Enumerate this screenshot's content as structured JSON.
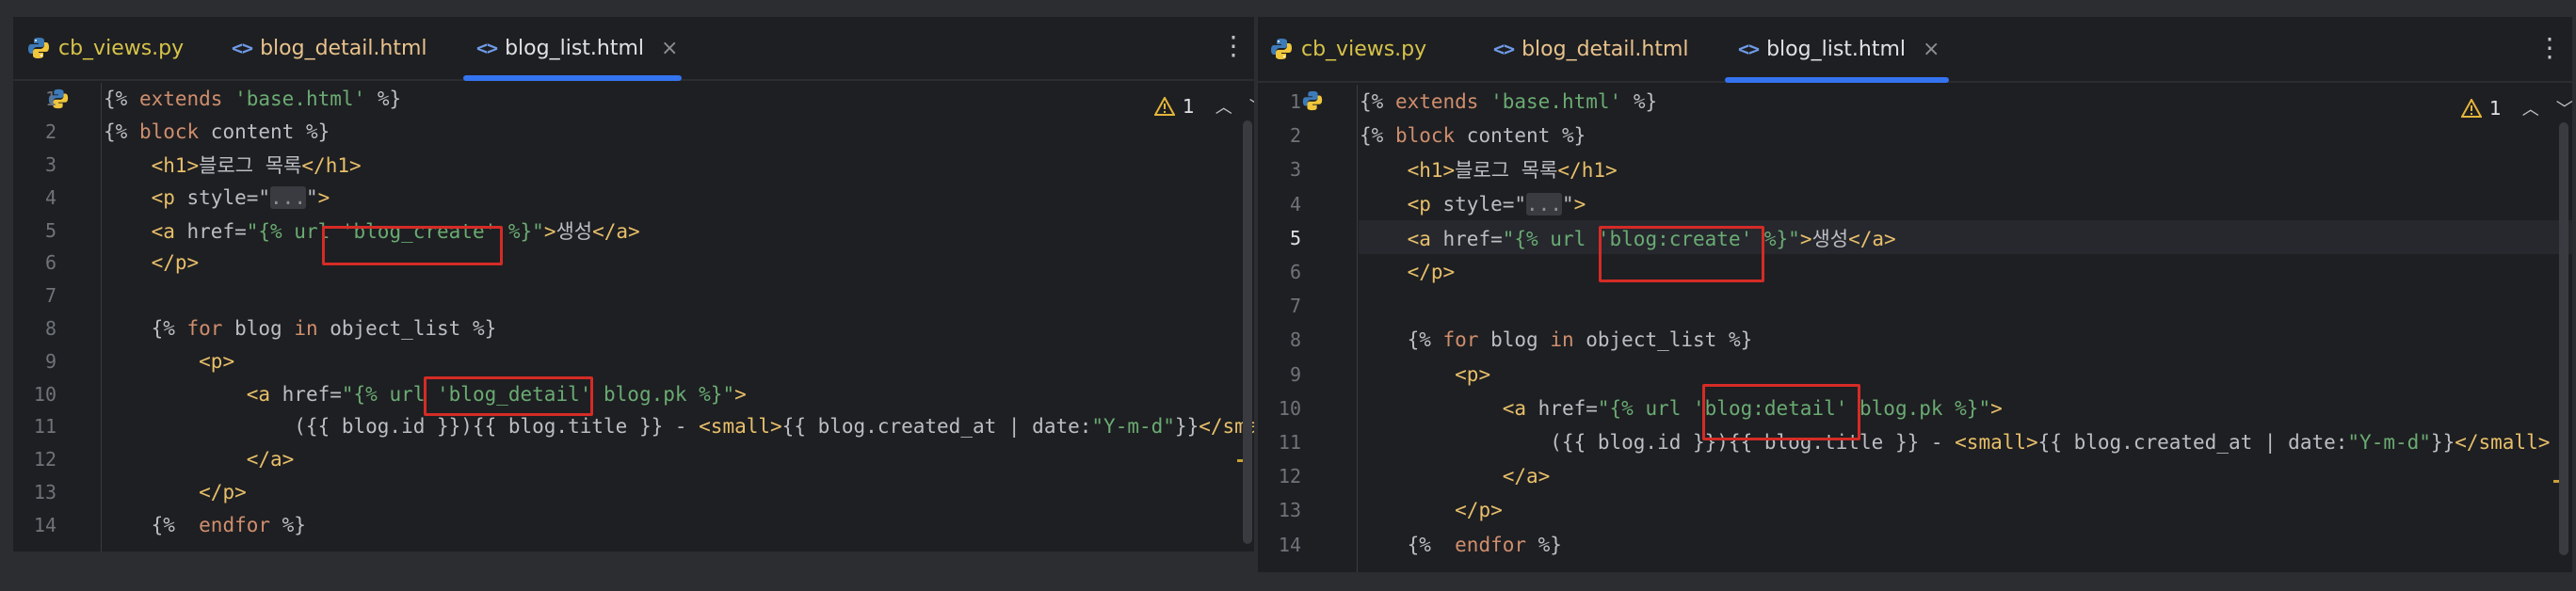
{
  "left": {
    "tabs": [
      {
        "icon": "python-file-icon",
        "label": "cb_views.py"
      },
      {
        "icon": "html-file-icon",
        "label": "blog_detail.html"
      },
      {
        "icon": "html-file-icon",
        "label": "blog_list.html",
        "close": "×",
        "active": true
      }
    ],
    "more": "⋮",
    "inspection": {
      "count": "1"
    },
    "lines": [
      {
        "n": "1",
        "code": "{% extends 'base.html' %}"
      },
      {
        "n": "2",
        "code": "{% block content %}"
      },
      {
        "n": "3",
        "code": "    <h1>블로그 목록</h1>"
      },
      {
        "n": "4",
        "code": "    <p style=\"...\">"
      },
      {
        "n": "5",
        "code": "    <a href=\"{% url 'blog_create' %}\">생성</a>"
      },
      {
        "n": "6",
        "code": "    </p>"
      },
      {
        "n": "7",
        "code": ""
      },
      {
        "n": "8",
        "code": "    {% for blog in object_list %}"
      },
      {
        "n": "9",
        "code": "        <p>"
      },
      {
        "n": "10",
        "code": "            <a href=\"{% url 'blog_detail' blog.pk %}\">"
      },
      {
        "n": "11",
        "code": "                ({{ blog.id }}){{ blog.title }} - <small>{{ blog.created_at | date:\"Y-m-d\"}}</small>"
      },
      {
        "n": "12",
        "code": "            </a>"
      },
      {
        "n": "13",
        "code": "        </p>"
      },
      {
        "n": "14",
        "code": "    {%  endfor %}"
      }
    ]
  },
  "right": {
    "tabs": [
      {
        "icon": "python-file-icon",
        "label": "cb_views.py"
      },
      {
        "icon": "html-file-icon",
        "label": "blog_detail.html"
      },
      {
        "icon": "html-file-icon",
        "label": "blog_list.html",
        "close": "×",
        "active": true
      }
    ],
    "more": "⋮",
    "inspection": {
      "count": "1"
    },
    "current_line": "5",
    "lines": [
      {
        "n": "1",
        "code": "{% extends 'base.html' %}"
      },
      {
        "n": "2",
        "code": "{% block content %}"
      },
      {
        "n": "3",
        "code": "    <h1>블로그 목록</h1>"
      },
      {
        "n": "4",
        "code": "    <p style=\"...\">"
      },
      {
        "n": "5",
        "code": "    <a href=\"{% url 'blog:create' %}\">생성</a>"
      },
      {
        "n": "6",
        "code": "    </p>"
      },
      {
        "n": "7",
        "code": ""
      },
      {
        "n": "8",
        "code": "    {% for blog in object_list %}"
      },
      {
        "n": "9",
        "code": "        <p>"
      },
      {
        "n": "10",
        "code": "            <a href=\"{% url 'blog:detail' blog.pk %}\">"
      },
      {
        "n": "11",
        "code": "                ({{ blog.id }}){{ blog.title }} - <small>{{ blog.created_at | date:\"Y-m-d\"}}</small>"
      },
      {
        "n": "12",
        "code": "            </a>"
      },
      {
        "n": "13",
        "code": "        </p>"
      },
      {
        "n": "14",
        "code": "    {%  endfor %}"
      }
    ]
  },
  "colors": {
    "background": "#2b2d30",
    "editor_bg": "#1e1f22",
    "keyword": "#cf8e6d",
    "string": "#6aab73",
    "tag": "#e8bf6a",
    "highlight_box": "#d52b26",
    "active_tab_underline": "#3574f0"
  }
}
